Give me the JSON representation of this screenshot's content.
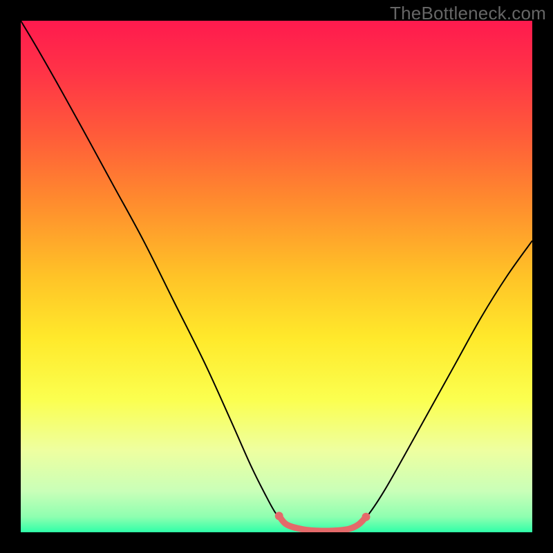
{
  "watermark": "TheBottleneck.com",
  "chart_data": {
    "type": "line",
    "title": "",
    "xlabel": "",
    "ylabel": "",
    "xlim": [
      0,
      100
    ],
    "ylim": [
      0,
      100
    ],
    "background_gradient_stops": [
      {
        "offset": 0,
        "color": "#ff1a4e"
      },
      {
        "offset": 0.1,
        "color": "#ff3347"
      },
      {
        "offset": 0.22,
        "color": "#ff5a3a"
      },
      {
        "offset": 0.35,
        "color": "#ff8a2e"
      },
      {
        "offset": 0.5,
        "color": "#ffc327"
      },
      {
        "offset": 0.62,
        "color": "#ffe92b"
      },
      {
        "offset": 0.74,
        "color": "#fbff4f"
      },
      {
        "offset": 0.84,
        "color": "#eeffa0"
      },
      {
        "offset": 0.92,
        "color": "#c9ffb8"
      },
      {
        "offset": 0.97,
        "color": "#8effb0"
      },
      {
        "offset": 1.0,
        "color": "#2fffa8"
      }
    ],
    "series": [
      {
        "name": "bottleneck-curve",
        "color": "#000000",
        "width": 2,
        "points": [
          {
            "x": 0,
            "y": 100
          },
          {
            "x": 3,
            "y": 95
          },
          {
            "x": 7,
            "y": 88
          },
          {
            "x": 12,
            "y": 79
          },
          {
            "x": 18,
            "y": 68
          },
          {
            "x": 24,
            "y": 57
          },
          {
            "x": 30,
            "y": 45
          },
          {
            "x": 36,
            "y": 33
          },
          {
            "x": 41,
            "y": 22
          },
          {
            "x": 45,
            "y": 13
          },
          {
            "x": 48,
            "y": 7
          },
          {
            "x": 50,
            "y": 3.5
          },
          {
            "x": 52,
            "y": 1.5
          },
          {
            "x": 55,
            "y": 0.6
          },
          {
            "x": 58,
            "y": 0.3
          },
          {
            "x": 61,
            "y": 0.3
          },
          {
            "x": 64,
            "y": 0.6
          },
          {
            "x": 66,
            "y": 1.5
          },
          {
            "x": 68,
            "y": 3.5
          },
          {
            "x": 71,
            "y": 8
          },
          {
            "x": 75,
            "y": 15
          },
          {
            "x": 80,
            "y": 24
          },
          {
            "x": 85,
            "y": 33
          },
          {
            "x": 90,
            "y": 42
          },
          {
            "x": 95,
            "y": 50
          },
          {
            "x": 100,
            "y": 57
          }
        ]
      },
      {
        "name": "valley-highlight",
        "color": "#e46a6a",
        "width": 9,
        "points": [
          {
            "x": 50.5,
            "y": 3.2
          },
          {
            "x": 52,
            "y": 1.5
          },
          {
            "x": 55,
            "y": 0.6
          },
          {
            "x": 58,
            "y": 0.3
          },
          {
            "x": 61,
            "y": 0.3
          },
          {
            "x": 64,
            "y": 0.6
          },
          {
            "x": 66,
            "y": 1.5
          },
          {
            "x": 67.5,
            "y": 3.0
          }
        ]
      }
    ],
    "highlight_endpoints": [
      {
        "x": 50.5,
        "y": 3.2
      },
      {
        "x": 67.5,
        "y": 3.0
      }
    ]
  }
}
